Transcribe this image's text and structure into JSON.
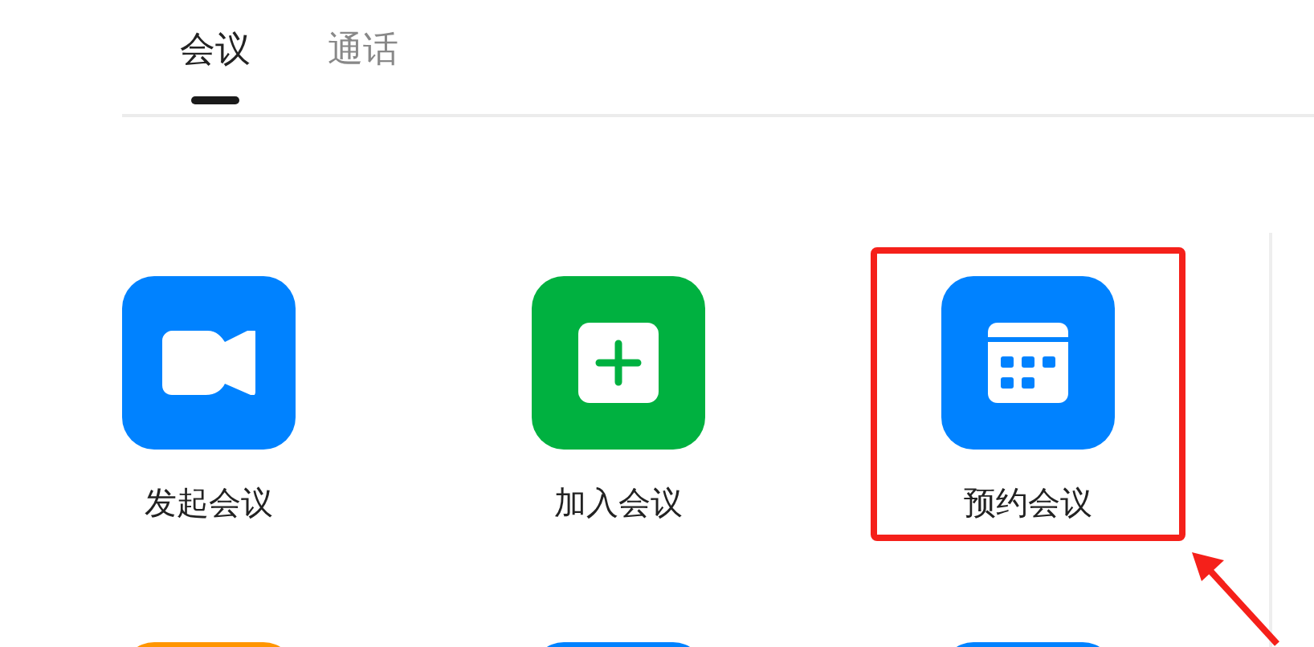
{
  "tabs": [
    {
      "label": "会议",
      "selected": true
    },
    {
      "label": "通话",
      "selected": false
    }
  ],
  "tile_rows": [
    [
      {
        "label": "发起会议",
        "kind": "video",
        "color": "#0082ff",
        "highlighted": false
      },
      {
        "label": "加入会议",
        "kind": "plus",
        "color": "#00b140",
        "highlighted": false
      },
      {
        "label": "预约会议",
        "kind": "calendar",
        "color": "#0082ff",
        "highlighted": true
      }
    ],
    [
      {
        "color": "#ff9500"
      },
      {
        "color": "#0082ff"
      },
      {
        "color": "#0082ff"
      }
    ]
  ],
  "annotation": {
    "kind": "arrow"
  }
}
